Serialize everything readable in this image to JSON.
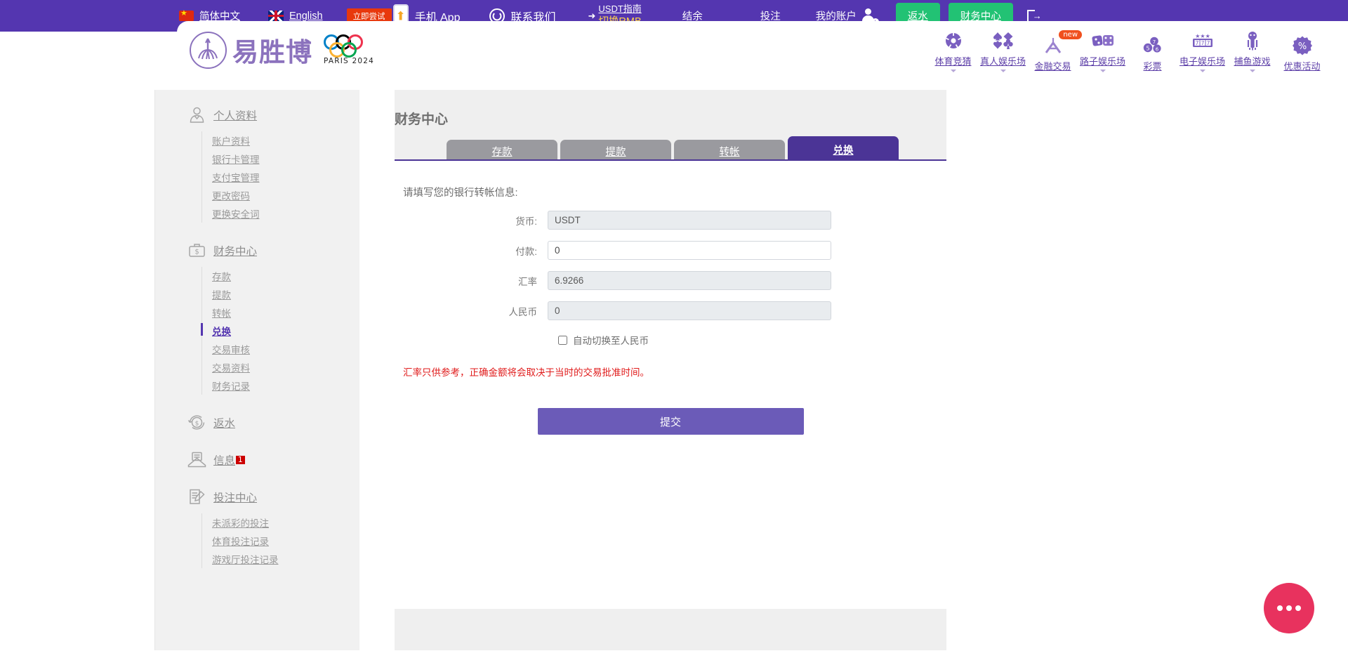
{
  "topbar": {
    "lang_cn": "简体中文",
    "lang_en": "English",
    "try_badge": "立即尝试",
    "mobile_app": "手机 App",
    "contact": "联系我们",
    "usdt_guide": "USDT指南",
    "switch_rmb": "切换RMB",
    "balance": "结余",
    "bet": "投注",
    "my_account": "我的账户",
    "rebate_button": "返水",
    "finance_button": "财务中心"
  },
  "header": {
    "brand": "易胜博",
    "olympic_text": "PARIS 2024",
    "nav": [
      {
        "label": "体育竞猜",
        "icon": "soccer-ball-icon",
        "caret": true,
        "badge": ""
      },
      {
        "label": "真人娱乐场",
        "icon": "card-suits-icon",
        "caret": true,
        "badge": ""
      },
      {
        "label": "金融交易",
        "icon": "finance-icon",
        "caret": false,
        "badge": "new"
      },
      {
        "label": "路子娱乐场",
        "icon": "dice-icon",
        "caret": true,
        "badge": ""
      },
      {
        "label": "彩票",
        "icon": "lottery-balls-icon",
        "caret": false,
        "badge": ""
      },
      {
        "label": "电子娱乐场",
        "icon": "slot-777-icon",
        "caret": true,
        "badge": ""
      },
      {
        "label": "捕鱼游戏",
        "icon": "fish-icon",
        "caret": true,
        "badge": ""
      },
      {
        "label": "优惠活动",
        "icon": "percent-icon",
        "caret": false,
        "badge": ""
      }
    ]
  },
  "sidebar": {
    "groups": [
      {
        "title": "个人资料",
        "icon": "person-icon",
        "items": [
          {
            "label": "账户资料",
            "active": false
          },
          {
            "label": "银行卡管理",
            "active": false
          },
          {
            "label": "支付宝管理",
            "active": false
          },
          {
            "label": "更改密码",
            "active": false
          },
          {
            "label": "更换安全词",
            "active": false
          }
        ]
      },
      {
        "title": "财务中心",
        "icon": "briefcase-dollar-icon",
        "items": [
          {
            "label": "存款",
            "active": false
          },
          {
            "label": "提款",
            "active": false
          },
          {
            "label": "转帐",
            "active": false
          },
          {
            "label": "兑换",
            "active": true
          },
          {
            "label": "交易审核",
            "active": false
          },
          {
            "label": "交易资料",
            "active": false
          },
          {
            "label": "财务记录",
            "active": false
          }
        ]
      },
      {
        "title": "返水",
        "icon": "refund-icon",
        "items": []
      },
      {
        "title": "信息",
        "icon": "envelope-icon",
        "badge": "1",
        "items": []
      },
      {
        "title": "投注中心",
        "icon": "note-pencil-icon",
        "items": [
          {
            "label": "未派彩的投注",
            "active": false
          },
          {
            "label": "体育投注记录",
            "active": false
          },
          {
            "label": "游戏厅投注记录",
            "active": false
          }
        ]
      }
    ]
  },
  "main": {
    "page_title": "财务中心",
    "tabs": [
      {
        "label": "存款",
        "active": false
      },
      {
        "label": "提款",
        "active": false
      },
      {
        "label": "转帐",
        "active": false
      },
      {
        "label": "兑换",
        "active": true
      }
    ],
    "form_note": "请填写您的银行转帐信息:",
    "fields": [
      {
        "label": "货币:",
        "value": "USDT",
        "readonly": true,
        "name": "currency-field"
      },
      {
        "label": "付款:",
        "value": "0",
        "readonly": false,
        "name": "payment-amount-field"
      },
      {
        "label": "汇率",
        "value": "6.9266",
        "readonly": true,
        "name": "exchange-rate-field"
      },
      {
        "label": "人民币",
        "value": "0",
        "readonly": true,
        "name": "rmb-amount-field"
      }
    ],
    "checkbox_label": "自动切换至人民币",
    "checkbox_checked": false,
    "warning": "汇率只供参考，正确金额将会取决于当时的交易批准时间。",
    "submit_label": "提交"
  },
  "colors": {
    "brand_purple": "#5436b0",
    "tab_active": "#4b3496",
    "green": "#22c274",
    "warn_red": "#e01b1b",
    "badge_orange": "#f0501e",
    "chat_pink": "#e8325e"
  }
}
